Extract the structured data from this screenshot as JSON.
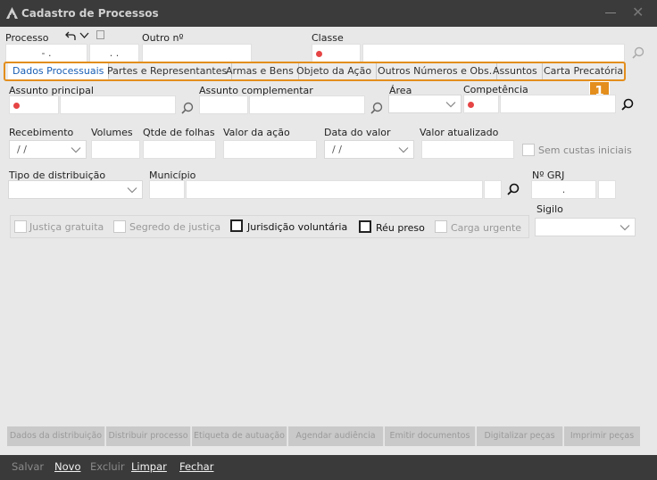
{
  "window": {
    "title": "Cadastro de Processos"
  },
  "header": {
    "processo_label": "Processo",
    "processo_value": "- .",
    "processo_sub": ". .",
    "outro_label": "Outro nº",
    "classe_label": "Classe"
  },
  "tabs": [
    {
      "label": "Dados Processuais"
    },
    {
      "label": "Partes e Representantes"
    },
    {
      "label": "Armas e Bens"
    },
    {
      "label": "Objeto da Ação"
    },
    {
      "label": "Outros Números e Obs."
    },
    {
      "label": "Assuntos"
    },
    {
      "label": "Carta Precatória"
    }
  ],
  "badge": "1",
  "form": {
    "assunto_principal": "Assunto principal",
    "assunto_complementar": "Assunto complementar",
    "area": "Área",
    "competencia": "Competência",
    "recebimento": "Recebimento",
    "recebimento_value": "/ /",
    "volumes": "Volumes",
    "qtde_folhas": "Qtde de folhas",
    "valor_acao": "Valor da ação",
    "data_valor": "Data do valor",
    "data_valor_value": "/ /",
    "valor_atualizado": "Valor atualizado",
    "sem_custas": "Sem custas iniciais",
    "tipo_distribuicao": "Tipo de distribuição",
    "municipio": "Município",
    "grj": "Nº GRJ",
    "grj_value": ".",
    "sigilo": "Sigilo"
  },
  "flags": {
    "justica_gratuita": "Justiça gratuita",
    "segredo_justica": "Segredo de justiça",
    "jurisdicao_voluntaria": "Jurisdição voluntária",
    "reu_preso": "Réu preso",
    "carga_urgente": "Carga urgente"
  },
  "actions": [
    "Dados da distribuição",
    "Distribuir processo",
    "Etiqueta de autuação",
    "Agendar audiência",
    "Emitir documentos",
    "Digitalizar peças",
    "Imprimir peças"
  ],
  "footer": {
    "salvar": "Salvar",
    "novo": "Novo",
    "excluir": "Excluir",
    "limpar": "Limpar",
    "fechar": "Fechar"
  },
  "colors": {
    "accent": "#e38e1d",
    "active_tab_text": "#1a5fb4",
    "required_dot": "#e64545",
    "titlebar": "#3b3b3b"
  }
}
